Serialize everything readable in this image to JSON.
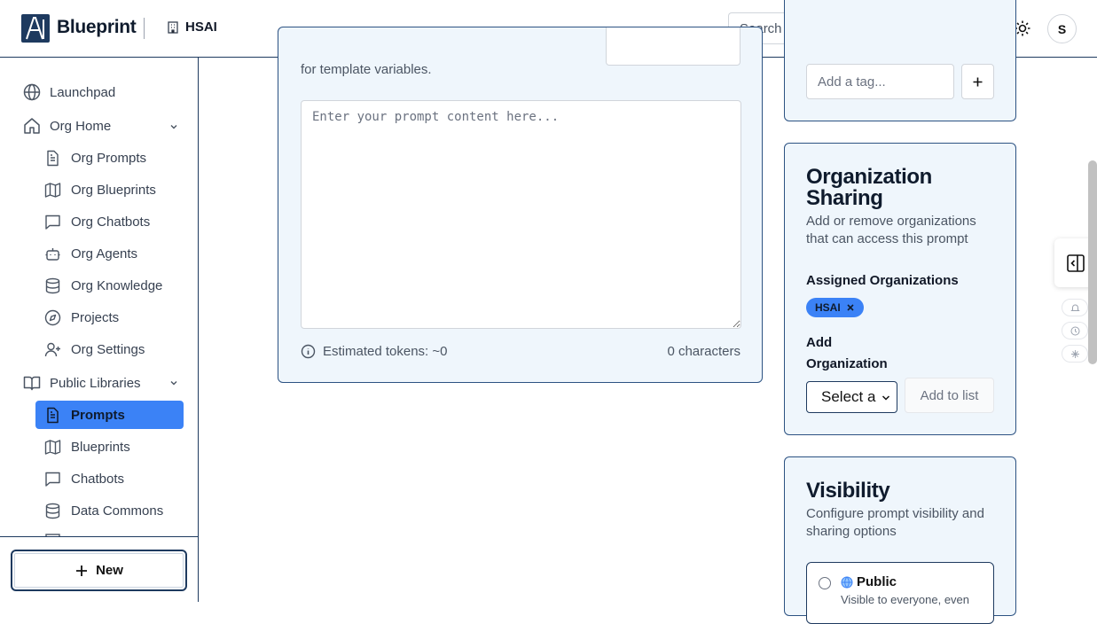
{
  "header": {
    "brand": "Blueprint",
    "org": "HSAI",
    "search_placeholder": "Search ...",
    "avatar_initial": "S"
  },
  "sidebar": {
    "items": [
      {
        "label": "Launchpad"
      },
      {
        "label": "Org Home"
      },
      {
        "label": "Org Prompts"
      },
      {
        "label": "Org Blueprints"
      },
      {
        "label": "Org Chatbots"
      },
      {
        "label": "Org Agents"
      },
      {
        "label": "Org Knowledge"
      },
      {
        "label": "Projects"
      },
      {
        "label": "Org Settings"
      },
      {
        "label": "Public Libraries"
      },
      {
        "label": "Prompts"
      },
      {
        "label": "Blueprints"
      },
      {
        "label": "Chatbots"
      },
      {
        "label": "Data Commons"
      }
    ],
    "new_button": "New"
  },
  "editor": {
    "hint_line2": "for template variables.",
    "content_placeholder": "Enter your prompt content here...",
    "tokens": "Estimated tokens: ~0",
    "characters": "0 characters"
  },
  "tags": {
    "placeholder": "Add a tag..."
  },
  "sharing": {
    "title_line1": "Organization",
    "title_line2": "Sharing",
    "description": "Add or remove organizations that can access this prompt",
    "assigned_label": "Assigned Organizations",
    "assigned_orgs": [
      "HSAI"
    ],
    "add_label_1": "Add",
    "add_label_2": "Organization",
    "select_value": "Select a",
    "add_to_list": "Add to list"
  },
  "visibility": {
    "title": "Visibility",
    "description": "Configure prompt visibility and sharing options",
    "option_label": "Public",
    "option_desc": "Visible to everyone, even"
  }
}
